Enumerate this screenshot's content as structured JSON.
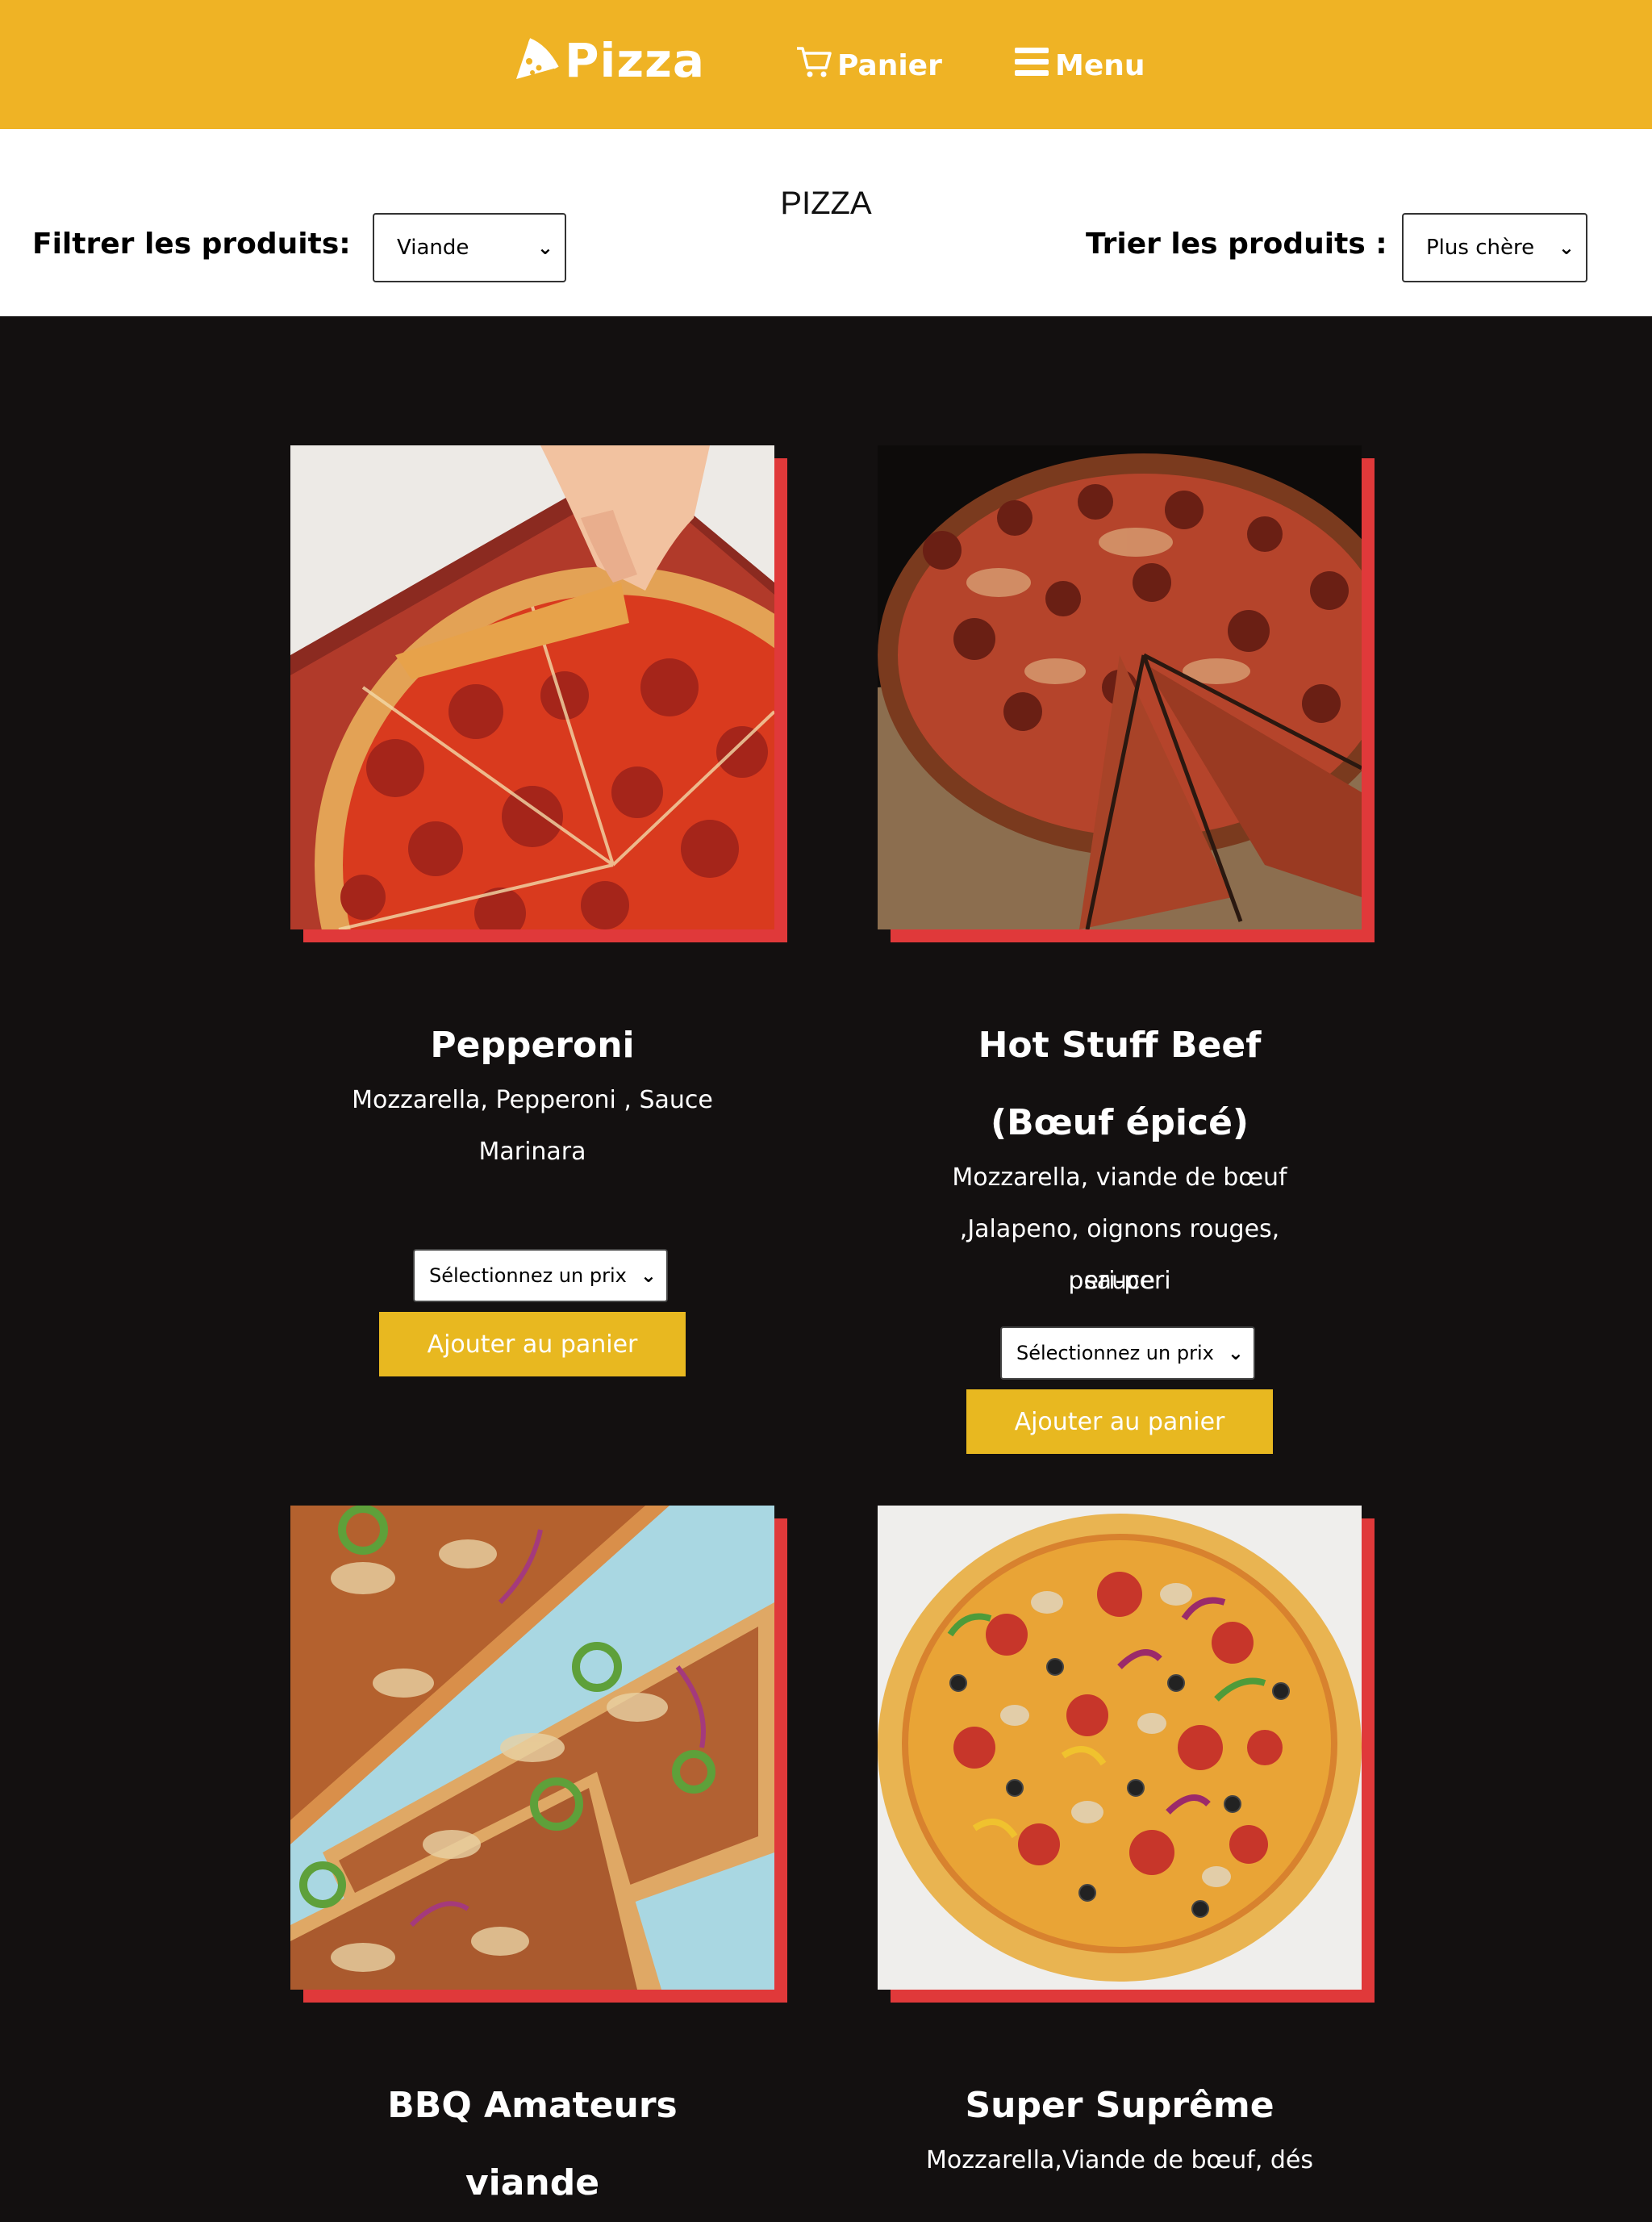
{
  "header": {
    "brand": "Pizza",
    "cart_label": "Panier",
    "menu_label": "Menu"
  },
  "filters": {
    "page_title": "PIZZA",
    "filter_label": "Filtrer les produits:",
    "filter_value": "Viande",
    "sort_label": "Trier les produits :",
    "sort_value": "Plus chère"
  },
  "products": [
    {
      "name_line1": "Pepperoni",
      "name_line2": "",
      "desc_line1": "Mozzarella, Pepperoni , Sauce",
      "desc_line2": "Marinara",
      "desc_line3": "",
      "price_placeholder": "Sélectionnez un prix",
      "add_label": "Ajouter au panier"
    },
    {
      "name_line1": "Hot Stuff Beef",
      "name_line2": "(Bœuf épicé)",
      "desc_line1": "Mozzarella, viande de bœuf",
      "desc_line2": ",Jalapeno, oignons rouges, sauce",
      "desc_line3": "peri-peri",
      "price_placeholder": "Sélectionnez un prix",
      "add_label": "Ajouter au panier"
    },
    {
      "name_line1": "BBQ Amateurs",
      "name_line2": "viande"
    },
    {
      "name_line1": "Super Suprême",
      "desc_line1": "Mozzarella,Viande de bœuf, dés"
    }
  ],
  "colors": {
    "header_bg": "#EFB325",
    "page_bg": "#131010",
    "accent_red": "#E0393A",
    "button_yellow": "#E8B820"
  }
}
